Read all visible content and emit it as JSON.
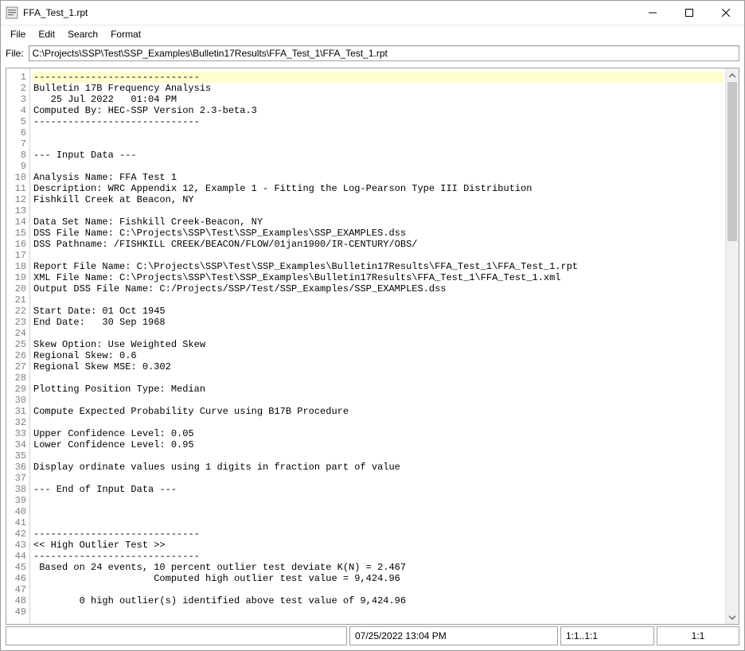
{
  "window": {
    "title": "FFA_Test_1.rpt"
  },
  "menu": {
    "file": "File",
    "edit": "Edit",
    "search": "Search",
    "format": "Format"
  },
  "filerow": {
    "label": "File:",
    "path": "C:\\Projects\\SSP\\Test\\SSP_Examples\\Bulletin17Results\\FFA_Test_1\\FFA_Test_1.rpt"
  },
  "editor": {
    "highlight_line": 1,
    "lines": [
      "-----------------------------",
      "Bulletin 17B Frequency Analysis",
      "   25 Jul 2022   01:04 PM",
      "Computed By: HEC-SSP Version 2.3-beta.3",
      "-----------------------------",
      "",
      "",
      "--- Input Data ---",
      "",
      "Analysis Name: FFA Test 1",
      "Description: WRC Appendix 12, Example 1 - Fitting the Log-Pearson Type III Distribution",
      "Fishkill Creek at Beacon, NY",
      "",
      "Data Set Name: Fishkill Creek-Beacon, NY",
      "DSS File Name: C:\\Projects\\SSP\\Test\\SSP_Examples\\SSP_EXAMPLES.dss",
      "DSS Pathname: /FISHKILL CREEK/BEACON/FLOW/01jan1900/IR-CENTURY/OBS/",
      "",
      "Report File Name: C:\\Projects\\SSP\\Test\\SSP_Examples\\Bulletin17Results\\FFA_Test_1\\FFA_Test_1.rpt",
      "XML File Name: C:\\Projects\\SSP\\Test\\SSP_Examples\\Bulletin17Results\\FFA_Test_1\\FFA_Test_1.xml",
      "Output DSS File Name: C:/Projects/SSP/Test/SSP_Examples/SSP_EXAMPLES.dss",
      "",
      "Start Date: 01 Oct 1945",
      "End Date:   30 Sep 1968",
      "",
      "Skew Option: Use Weighted Skew",
      "Regional Skew: 0.6",
      "Regional Skew MSE: 0.302",
      "",
      "Plotting Position Type: Median",
      "",
      "Compute Expected Probability Curve using B17B Procedure",
      "",
      "Upper Confidence Level: 0.05",
      "Lower Confidence Level: 0.95",
      "",
      "Display ordinate values using 1 digits in fraction part of value",
      "",
      "--- End of Input Data ---",
      "",
      "",
      "",
      "-----------------------------",
      "<< High Outlier Test >>",
      "-----------------------------",
      " Based on 24 events, 10 percent outlier test deviate K(N) = 2.467",
      "                     Computed high outlier test value = 9,424.96",
      "",
      "        0 high outlier(s) identified above test value of 9,424.96",
      ""
    ]
  },
  "status": {
    "message": "",
    "datetime": "07/25/2022 13:04 PM",
    "selection": "1:1..1:1",
    "position": "1:1"
  }
}
